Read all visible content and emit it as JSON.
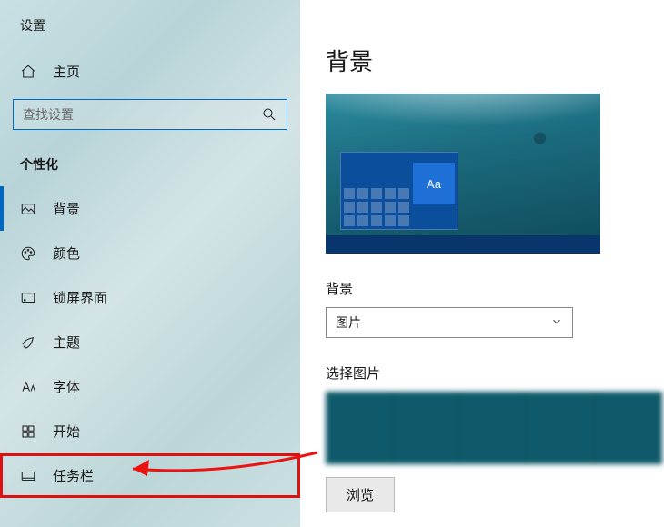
{
  "sidebar": {
    "title": "设置",
    "home_label": "主页",
    "search_placeholder": "查找设置",
    "section_label": "个性化",
    "items": [
      {
        "label": "背景"
      },
      {
        "label": "颜色"
      },
      {
        "label": "锁屏界面"
      },
      {
        "label": "主题"
      },
      {
        "label": "字体"
      },
      {
        "label": "开始"
      },
      {
        "label": "任务栏"
      }
    ]
  },
  "main": {
    "title": "背景",
    "preview_tile_text": "Aa",
    "bg_field_label": "背景",
    "bg_select_value": "图片",
    "choose_label": "选择图片",
    "browse_label": "浏览"
  }
}
